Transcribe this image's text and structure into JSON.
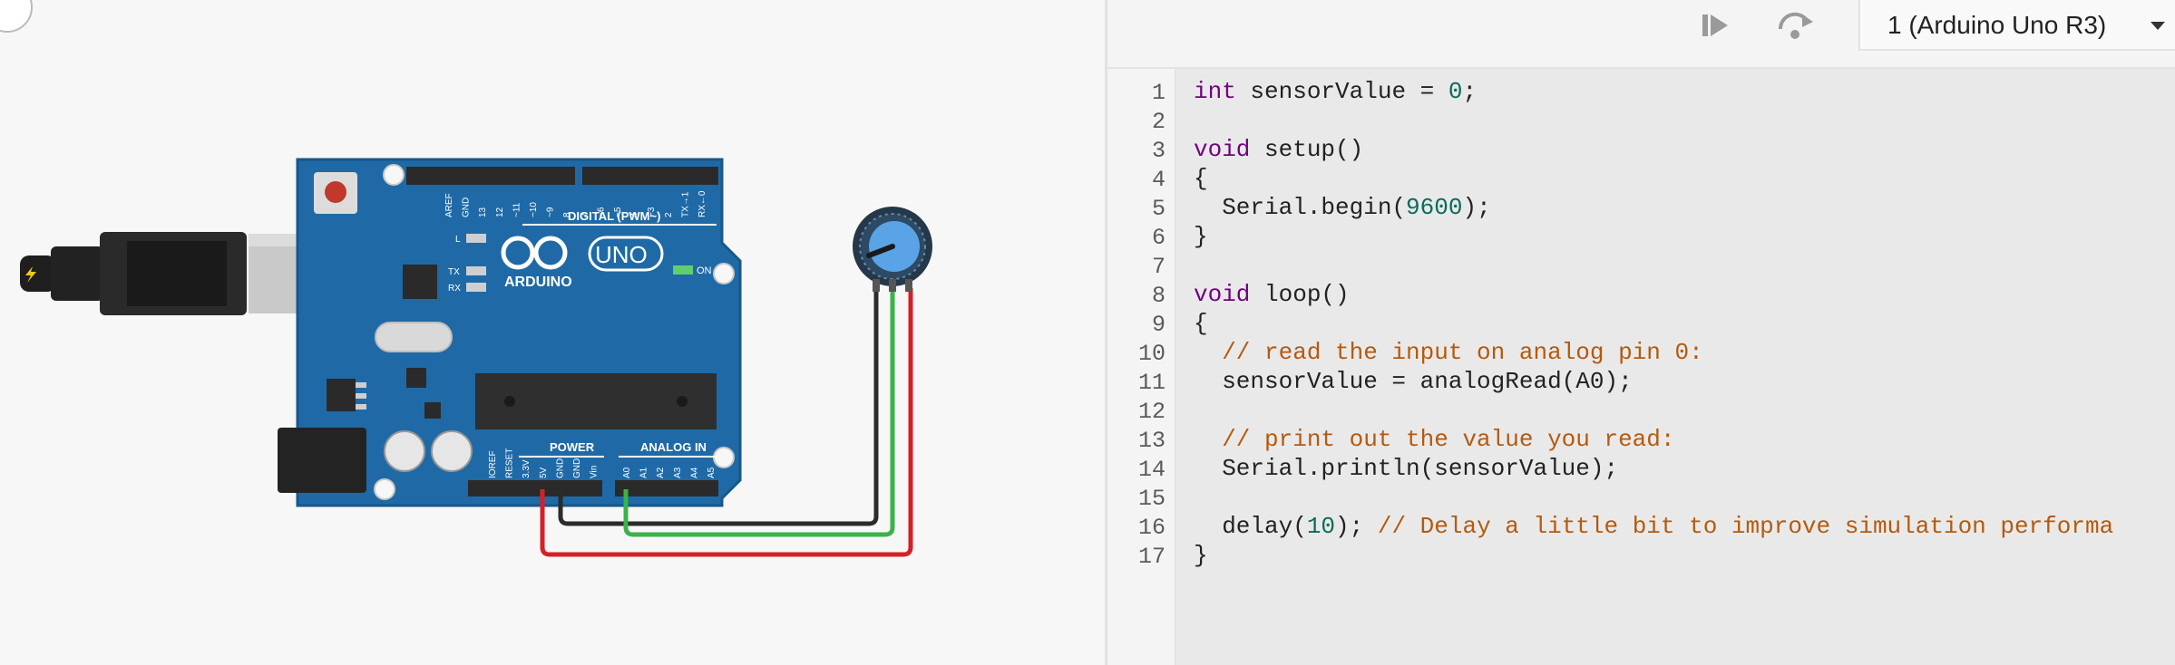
{
  "toolbar": {
    "step_icon": "step-forward-icon",
    "restart_icon": "step-over-icon",
    "device_select_value": "1 (Arduino Uno R3)"
  },
  "circuit": {
    "board_brand": "ARDUINO",
    "board_model": "UNO",
    "on_label": "ON",
    "digital_label": "DIGITAL (PWM~)",
    "power_label": "POWER",
    "analog_label": "ANALOG IN",
    "l_label": "L",
    "tx_label": "TX",
    "rx_label": "RX",
    "digital_pins": [
      "AREF",
      "GND",
      "13",
      "12",
      "~11",
      "~10",
      "~9",
      "8",
      "7",
      "~6",
      "~5",
      "4",
      "~3",
      "2",
      "TX→1",
      "RX←0"
    ],
    "power_pins": [
      "IOREF",
      "RESET",
      "3.3V",
      "5V",
      "GND",
      "GND",
      "Vin"
    ],
    "analog_pins": [
      "A0",
      "A1",
      "A2",
      "A3",
      "A4",
      "A5"
    ],
    "wire_colors": {
      "power": "#d62027",
      "ground": "#2b2b2b",
      "signal": "#3ab34a"
    }
  },
  "editor": {
    "lines": [
      [
        {
          "t": "int",
          "c": "kw"
        },
        {
          "t": " sensorValue = ",
          "c": ""
        },
        {
          "t": "0",
          "c": "num"
        },
        {
          "t": ";",
          "c": ""
        }
      ],
      [],
      [
        {
          "t": "void",
          "c": "kw"
        },
        {
          "t": " setup()",
          "c": ""
        }
      ],
      [
        {
          "t": "{",
          "c": ""
        }
      ],
      [
        {
          "t": "  Serial.begin(",
          "c": ""
        },
        {
          "t": "9600",
          "c": "num"
        },
        {
          "t": ");",
          "c": ""
        }
      ],
      [
        {
          "t": "}",
          "c": ""
        }
      ],
      [],
      [
        {
          "t": "void",
          "c": "kw"
        },
        {
          "t": " loop()",
          "c": ""
        }
      ],
      [
        {
          "t": "{",
          "c": ""
        }
      ],
      [
        {
          "t": "  // read the input on analog pin 0:",
          "c": "cm"
        }
      ],
      [
        {
          "t": "  sensorValue = analogRead(A0);",
          "c": ""
        }
      ],
      [],
      [
        {
          "t": "  // print out the value you read:",
          "c": "cm"
        }
      ],
      [
        {
          "t": "  Serial.println(sensorValue);",
          "c": ""
        }
      ],
      [],
      [
        {
          "t": "  delay(",
          "c": ""
        },
        {
          "t": "10",
          "c": "num"
        },
        {
          "t": "); ",
          "c": ""
        },
        {
          "t": "// Delay a little bit to improve simulation performa",
          "c": "cm"
        }
      ],
      [
        {
          "t": "}",
          "c": ""
        }
      ]
    ],
    "line_numbers": [
      "1",
      "2",
      "3",
      "4",
      "5",
      "6",
      "7",
      "8",
      "9",
      "10",
      "11",
      "12",
      "13",
      "14",
      "15",
      "16",
      "17"
    ]
  }
}
